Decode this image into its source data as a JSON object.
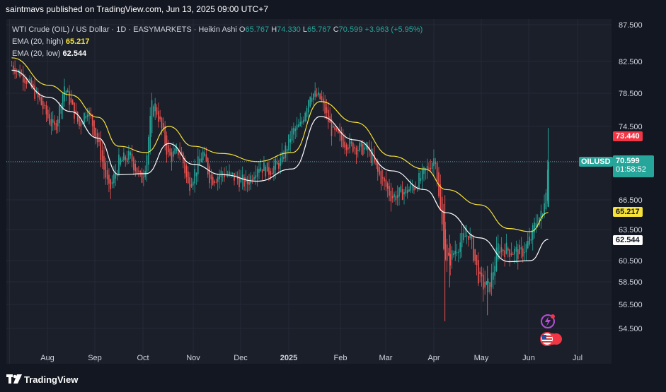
{
  "header": {
    "published": "saintmavs published on TradingView.com, Jun 13, 2025 09:00 UTC+7"
  },
  "legend": {
    "symbol": "WTI Crude (OIL) / US Dollar · 1D · EASYMARKETS · Heikin Ashi",
    "o_label": "O",
    "o_value": "65.767",
    "h_label": "H",
    "h_value": "74.330",
    "l_label": "L",
    "l_value": "65.767",
    "c_label": "C",
    "c_value": "70.599",
    "change": "+3.963 (+5.95%)",
    "ema_high_label": "EMA (20, high)",
    "ema_high_value": "65.217",
    "ema_low_label": "EMA (20, low)",
    "ema_low_value": "62.544"
  },
  "price_badges": {
    "high": "73.440",
    "symbol_tag": "OILUSD",
    "last": "70.599",
    "countdown": "01:58:52",
    "ema_high": "65.217",
    "ema_low": "62.544"
  },
  "colors": {
    "up": "#26a69a",
    "down": "#ef5350",
    "ema_high": "#f6e23b",
    "ema_low": "#ffffff",
    "background": "#1b1f2a",
    "last_price": "#26a69a",
    "high_badge": "#f23645"
  },
  "footer": {
    "brand": "TradingView"
  },
  "icons": [
    "tradingview-logo-icon",
    "lightning-event-icon",
    "us-flag-event-icon"
  ],
  "chart_data": {
    "type": "candlestick",
    "style": "Heikin Ashi",
    "symbol": "WTI Crude (OIL) / US Dollar",
    "timeframe": "1D",
    "y_ticks": [
      "87.500",
      "82.500",
      "78.500",
      "74.500",
      "70.500",
      "66.500",
      "63.500",
      "60.500",
      "58.500",
      "56.500",
      "54.500"
    ],
    "x_ticks": [
      "Aug",
      "Sep",
      "Oct",
      "Nov",
      "Dec",
      "2025",
      "Feb",
      "Mar",
      "Apr",
      "May",
      "Jun",
      "Jul"
    ],
    "ylim": [
      53.2,
      88.5
    ],
    "last_price": 70.599,
    "high_marker": 73.44,
    "ema_high_last": 65.217,
    "ema_low_last": 62.544,
    "close_path": [
      [
        "Jul 15",
        82.0
      ],
      [
        "Jul 22",
        80.2
      ],
      [
        "Jul 29",
        77.2
      ],
      [
        "Aug 02",
        75.3
      ],
      [
        "Aug 06",
        74.2
      ],
      [
        "Aug 12",
        79.5
      ],
      [
        "Aug 16",
        77.3
      ],
      [
        "Aug 22",
        74.5
      ],
      [
        "Aug 27",
        76.8
      ],
      [
        "Sep 03",
        72.6
      ],
      [
        "Sep 10",
        67.3
      ],
      [
        "Sep 16",
        70.6
      ],
      [
        "Sep 23",
        71.2
      ],
      [
        "Sep 30",
        68.5
      ],
      [
        "Oct 03",
        70.8
      ],
      [
        "Oct 07",
        77.9
      ],
      [
        "Oct 11",
        75.3
      ],
      [
        "Oct 17",
        71.0
      ],
      [
        "Oct 24",
        71.9
      ],
      [
        "Oct 29",
        67.9
      ],
      [
        "Nov 07",
        71.6
      ],
      [
        "Nov 12",
        68.6
      ],
      [
        "Nov 19",
        69.4
      ],
      [
        "Nov 27",
        68.9
      ],
      [
        "Dec 05",
        68.2
      ],
      [
        "Dec 12",
        70.3
      ],
      [
        "Dec 19",
        69.6
      ],
      [
        "Dec 27",
        70.6
      ],
      [
        "Jan 03",
        73.9
      ],
      [
        "Jan 08",
        74.6
      ],
      [
        "Jan 14",
        78.7
      ],
      [
        "Jan 20",
        77.8
      ],
      [
        "Jan 27",
        73.9
      ],
      [
        "Feb 03",
        72.8
      ],
      [
        "Feb 10",
        72.2
      ],
      [
        "Feb 18",
        71.9
      ],
      [
        "Feb 24",
        69.4
      ],
      [
        "Mar 05",
        66.8
      ],
      [
        "Mar 12",
        67.3
      ],
      [
        "Mar 19",
        67.9
      ],
      [
        "Mar 26",
        69.4
      ],
      [
        "Apr 02",
        71.2
      ],
      [
        "Apr 04",
        66.8
      ],
      [
        "Apr 09",
        60.0
      ],
      [
        "Apr 16",
        62.0
      ],
      [
        "Apr 23",
        63.2
      ],
      [
        "Apr 30",
        58.5
      ],
      [
        "May 06",
        57.8
      ],
      [
        "May 12",
        61.8
      ],
      [
        "May 19",
        61.5
      ],
      [
        "May 27",
        61.2
      ],
      [
        "Jun 02",
        62.5
      ],
      [
        "Jun 06",
        64.6
      ],
      [
        "Jun 10",
        65.0
      ],
      [
        "Jun 11",
        67.8
      ],
      [
        "Jun 12",
        68.2
      ],
      [
        "Jun 13",
        70.6
      ]
    ],
    "ema_high_path": [
      [
        "Jul 15",
        83.0
      ],
      [
        "Aug 02",
        79.5
      ],
      [
        "Aug 16",
        78.3
      ],
      [
        "Sep 03",
        75.6
      ],
      [
        "Sep 16",
        72.3
      ],
      [
        "Oct 03",
        71.6
      ],
      [
        "Oct 17",
        74.5
      ],
      [
        "Nov 01",
        72.3
      ],
      [
        "Nov 19",
        71.5
      ],
      [
        "Dec 12",
        70.6
      ],
      [
        "Jan 03",
        71.6
      ],
      [
        "Jan 20",
        77.5
      ],
      [
        "Feb 10",
        75.0
      ],
      [
        "Mar 05",
        71.2
      ],
      [
        "Mar 26",
        69.8
      ],
      [
        "Apr 09",
        67.6
      ],
      [
        "Apr 30",
        66.0
      ],
      [
        "May 19",
        63.6
      ],
      [
        "Jun 02",
        63.3
      ],
      [
        "Jun 13",
        65.217
      ]
    ],
    "ema_low_path": [
      [
        "Jul 15",
        81.4
      ],
      [
        "Aug 02",
        78.0
      ],
      [
        "Aug 16",
        76.3
      ],
      [
        "Sep 03",
        73.2
      ],
      [
        "Sep 16",
        69.2
      ],
      [
        "Oct 03",
        69.3
      ],
      [
        "Oct 17",
        72.6
      ],
      [
        "Nov 01",
        70.3
      ],
      [
        "Nov 19",
        69.2
      ],
      [
        "Dec 12",
        68.5
      ],
      [
        "Jan 03",
        69.8
      ],
      [
        "Jan 20",
        75.7
      ],
      [
        "Feb 10",
        73.0
      ],
      [
        "Mar 05",
        69.6
      ],
      [
        "Mar 26",
        67.6
      ],
      [
        "Apr 09",
        65.2
      ],
      [
        "Apr 30",
        62.7
      ],
      [
        "May 19",
        60.4
      ],
      [
        "Jun 02",
        60.5
      ],
      [
        "Jun 13",
        62.544
      ]
    ]
  }
}
